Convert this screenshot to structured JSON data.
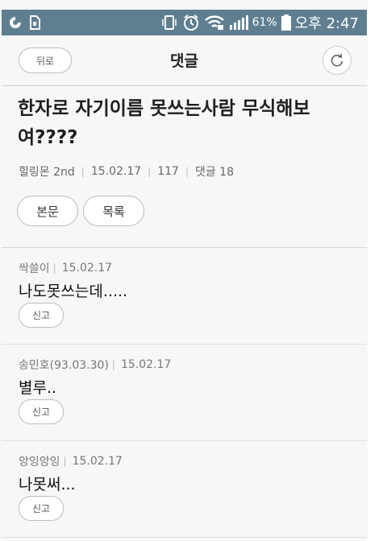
{
  "status_bar": {
    "icons_left": [
      "carrier-icon",
      "sim-icon"
    ],
    "battery_percent": "61%",
    "time": "오후 2:47"
  },
  "header": {
    "back_label": "뒤로",
    "title": "댓글",
    "refresh_icon": "refresh-icon"
  },
  "post": {
    "title": "한자로 자기이름 못쓰는사람 무식해보여????",
    "author": "힐링몬 2nd",
    "date": "15.02.17",
    "views": "117",
    "comment_count": "댓글 18",
    "buttons": {
      "body": "본문",
      "list": "목록"
    }
  },
  "comments": [
    {
      "author": "싹쓸이",
      "date": "15.02.17",
      "text": "나도못쓰는데.....",
      "report_label": "신고"
    },
    {
      "author": "송민호(93.03.30)",
      "date": "15.02.17",
      "text": "별루..",
      "report_label": "신고"
    },
    {
      "author": "앙잉앙잉",
      "date": "15.02.17",
      "text": "나못써...",
      "report_label": "신고"
    }
  ]
}
